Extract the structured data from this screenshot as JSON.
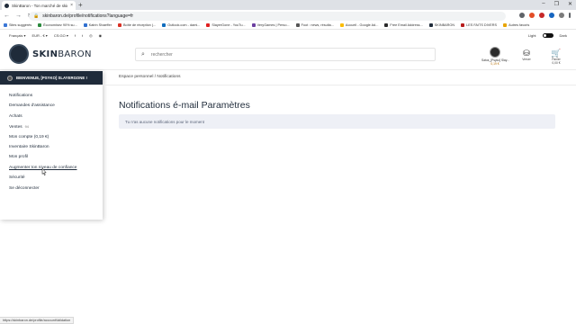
{
  "browser": {
    "tab_title": "SkinBaron - Ton marché de skins...",
    "tab_close": "×",
    "new_tab": "+",
    "window_controls": [
      "–",
      "❐",
      "✕"
    ],
    "url": "skinbaron.de/profile/notifications?language=fr",
    "bookmarks": [
      {
        "label": "Sites suggérés",
        "color": "#3a76d6"
      },
      {
        "label": "Économisez 90% su...",
        "color": "#2b8a3e"
      },
      {
        "label": "Katrin Shaeffer",
        "color": "#2f6fd0"
      },
      {
        "label": "Boîte de réception (...",
        "color": "#d93025"
      },
      {
        "label": "Outlook.com - dami...",
        "color": "#0f6cbd"
      },
      {
        "label": "SlayerGone - YouTu...",
        "color": "#e02020"
      },
      {
        "label": "VeryGames | Perso...",
        "color": "#6b3fa0"
      },
      {
        "label": "Foot : news, résulta...",
        "color": "#555555"
      },
      {
        "label": "Accueil - Google Ad...",
        "color": "#fbbc04"
      },
      {
        "label": "Free Email Address...",
        "color": "#2a2a2a"
      },
      {
        "label": "SKINBARON",
        "color": "#1f2b3a"
      },
      {
        "label": "LES FAITS DIVERS",
        "color": "#b71c1c"
      },
      {
        "label": "Autres favoris",
        "color": "#e8a400"
      }
    ],
    "status_url": "https://skinbaron.de/profile/accountValidation"
  },
  "topbar": {
    "language": "Français ▾",
    "currency": "EUR - € ▾",
    "game": "CS:GO ▾",
    "social": [
      "f",
      "t",
      "◎",
      "◉"
    ],
    "theme_light": "Light",
    "theme_dark": "Dark"
  },
  "header": {
    "logo_word_bold": "SKIN",
    "logo_word_light": "BARON",
    "search_placeholder": "rechercher",
    "user_name": "Satus_[Psyko] Slay...",
    "user_balance": "0,19 €",
    "deposit_label": "Verser",
    "cart_label": "Panier",
    "cart_amount": "0,00 €"
  },
  "sidebar": {
    "welcome": "BIENVENUE, [PSYKO] SLAYERGONE !",
    "items": [
      {
        "label": "Notifications",
        "count": ""
      },
      {
        "label": "Demandes d'assistance",
        "count": ""
      },
      {
        "label": "Achats",
        "count": ""
      },
      {
        "label": "Ventes",
        "count": "94"
      },
      {
        "label": "Mon compte (0,19 €)",
        "count": ""
      },
      {
        "label": "Inventaire SkinBaron",
        "count": ""
      },
      {
        "label": "Mon profil",
        "count": ""
      },
      {
        "label": "Augmenter ton niveau de confiance",
        "count": ""
      },
      {
        "label": "Sécurité",
        "count": ""
      },
      {
        "label": "Se déconnecter",
        "count": ""
      }
    ]
  },
  "main": {
    "breadcrumb": "Espace personnel / Notifications",
    "title": "Notifications é-mail Paramètres",
    "empty_message": "Tu n'as aucune notifications pour le moment"
  },
  "colors": {
    "brand_dark": "#1f2b3a",
    "notice_bg": "#eef0f6",
    "balance": "#b56d00"
  }
}
